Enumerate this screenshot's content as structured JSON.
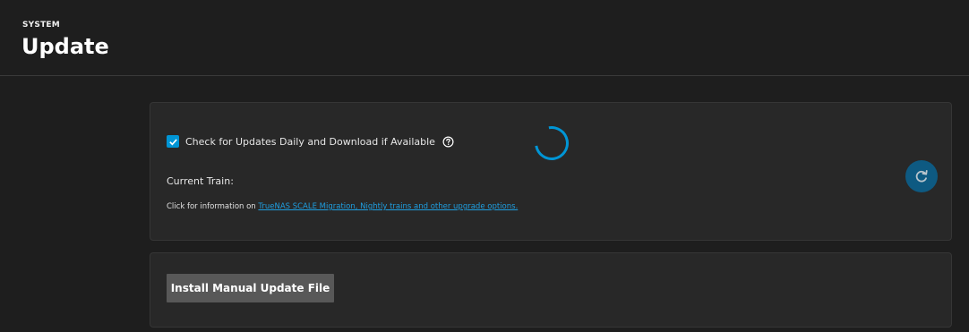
{
  "header": {
    "breadcrumb": "SYSTEM",
    "title": "Update"
  },
  "updates_card": {
    "auto_check": {
      "label": "Check for Updates Daily and Download if Available",
      "checked": true
    },
    "current_train_label": "Current Train:",
    "info_prefix": "Click for information on ",
    "info_link": "TrueNAS SCALE Migration, Nightly trains and other upgrade options."
  },
  "manual_card": {
    "install_label": "Install Manual Update File"
  },
  "icons": {
    "help": "help-circle-icon",
    "refresh": "refresh-icon",
    "loading": "loading-spinner"
  },
  "colors": {
    "accent": "#0095d5",
    "link": "#1e9ee0",
    "background": "#1e1e1e",
    "card": "#282828"
  }
}
